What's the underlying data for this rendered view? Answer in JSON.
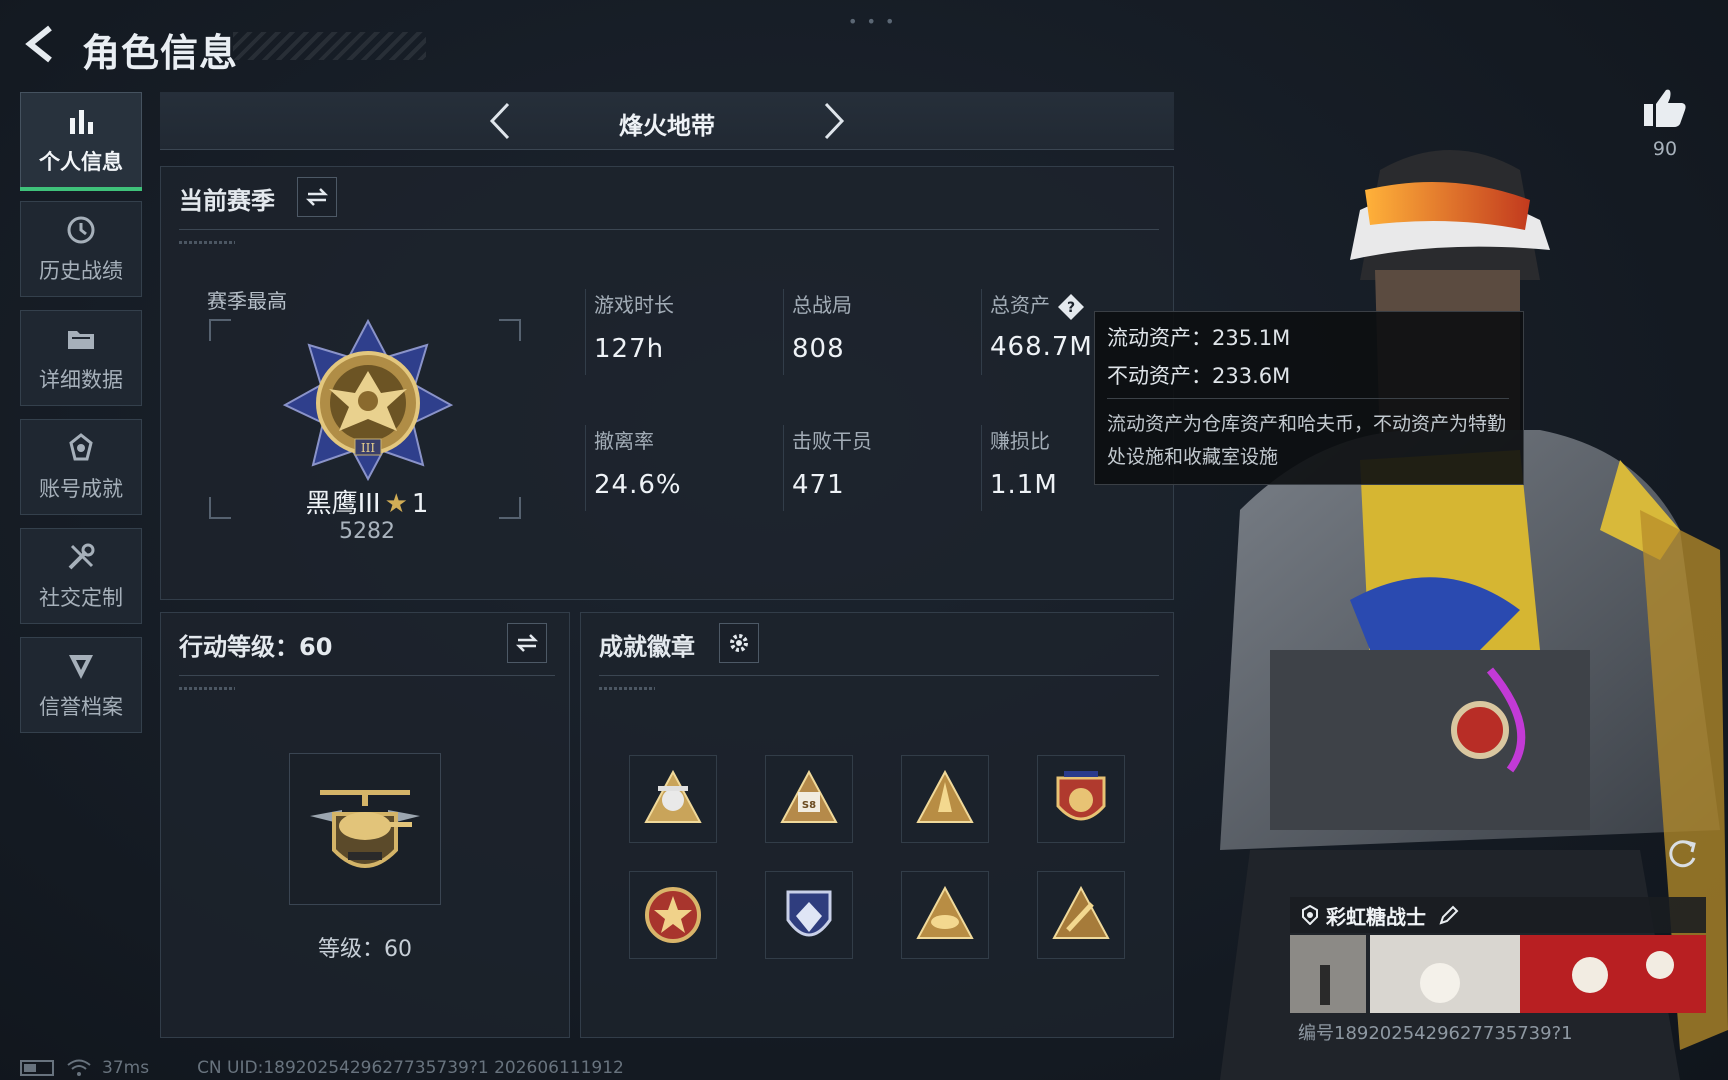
{
  "header": {
    "title": "角色信息"
  },
  "sidebar": {
    "items": [
      {
        "label": "个人信息",
        "icon": "bar-chart-icon"
      },
      {
        "label": "历史战绩",
        "icon": "history-clock-icon"
      },
      {
        "label": "详细数据",
        "icon": "folder-icon"
      },
      {
        "label": "账号成就",
        "icon": "medal-icon"
      },
      {
        "label": "社交定制",
        "icon": "tools-icon"
      },
      {
        "label": "信誉档案",
        "icon": "shield-icon"
      }
    ]
  },
  "mode": {
    "title": "烽火地带"
  },
  "season": {
    "heading": "当前赛季",
    "best_label": "赛季最高",
    "rank_name": "黑鹰III",
    "rank_star": "★",
    "rank_star_count": "1",
    "rank_score": "5282",
    "stats": [
      {
        "label": "游戏时长",
        "value": "127h"
      },
      {
        "label": "总战局",
        "value": "808"
      },
      {
        "label": "总资产",
        "value": "468.7M"
      },
      {
        "label": "撤离率",
        "value": "24.6%"
      },
      {
        "label": "击败干员",
        "value": "471"
      },
      {
        "label": "赚损比",
        "value": "1.1M"
      }
    ]
  },
  "tooltip": {
    "liquid": "流动资产：235.1M",
    "fixed": "不动资产：233.6M",
    "description": "流动资产为仓库资产和哈夫币，不动资产为特勤处设施和收藏室设施"
  },
  "action_level": {
    "heading": "行动等级：60",
    "level_text": "等级：60"
  },
  "achievements": {
    "heading": "成就徽章",
    "badges": [
      "badge-1",
      "badge-2",
      "badge-3",
      "badge-4",
      "badge-5",
      "badge-6",
      "badge-7",
      "badge-8"
    ]
  },
  "character": {
    "likes": "90",
    "name": "彩虹糖战士",
    "serial": "编号1892025429627735739?1"
  },
  "status": {
    "ping": "37ms",
    "uid": "CN UID:1892025429627735739?1 202606111912"
  },
  "colors": {
    "accent_green": "#3fc27a",
    "gold": "#d1ad56",
    "panel_bg": "#1d242d"
  }
}
